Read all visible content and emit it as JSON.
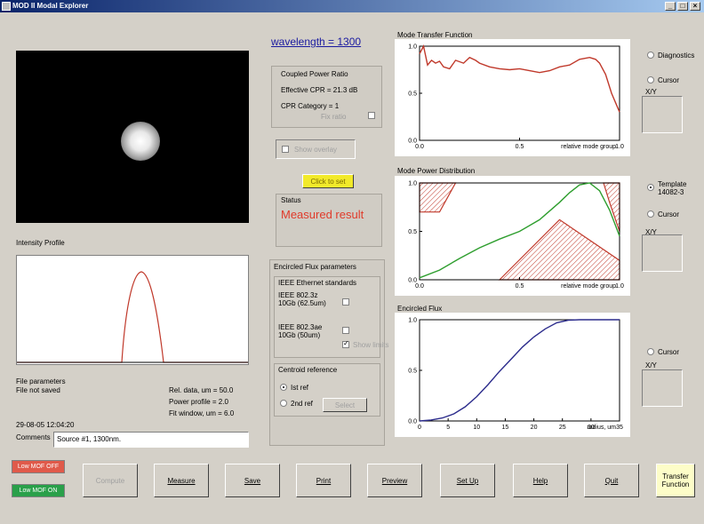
{
  "window": {
    "title": "MOD II Modal Explorer"
  },
  "wavelength_label": "wavelength = 1300",
  "cpr": {
    "title": "Coupled Power Ratio",
    "effective": "Effective CPR = 21.3 dB",
    "category": "CPR Category = 1",
    "sub_label": "Fix ratio"
  },
  "show_overlay": "Show overlay",
  "yellow_button": "Click to set",
  "status": {
    "title": "Status",
    "value": "Measured result"
  },
  "intensity": {
    "title": "Intensity Profile"
  },
  "file": {
    "title": "File parameters",
    "saved": "File not saved",
    "datetime": "29-08-05 12:04:20",
    "comments_label": "Comments",
    "comments_value": "Source #1, 1300nm."
  },
  "params": {
    "rel": "Rel. data, um = 50.0",
    "power": "Power profile = 2.0",
    "fit": "Fit window, um = 6.0"
  },
  "ef_params": {
    "title": "Encircled Flux parameters",
    "ieee_title": "IEEE Ethernet standards",
    "ieee1": "IEEE 802.3z\n10Gb (62.5um)",
    "ieee2": "IEEE 802.3ae\n10Gb (50um)",
    "ieee2_sub": "Show limits"
  },
  "centroid": {
    "title": "Centroid reference",
    "opt1": "Ist ref",
    "opt2": "2nd ref",
    "set_button": "Select"
  },
  "charts": {
    "mtf_title": "Mode Transfer Function",
    "mpd_title": "Mode Power Distribution",
    "ef_title": "Encircled Flux"
  },
  "right": {
    "diagnostics": "Diagnostics",
    "cursor": "Cursor",
    "xy": "X/Y",
    "template": "Template\n14082-3"
  },
  "bottom": {
    "led1": "Low MOF OFF",
    "led2": "Low MOF ON",
    "buttons": [
      "Compute",
      "Measure",
      "Save",
      "Print",
      "Preview",
      "Set Up",
      "Help",
      "Quit"
    ],
    "transfer": "Transfer\nFunction"
  },
  "chart_data": [
    {
      "type": "line",
      "title": "Mode Transfer Function",
      "xlabel": "relative mode group",
      "ylabel": "",
      "xlim": [
        0,
        1.0
      ],
      "ylim": [
        0,
        1.0
      ],
      "x_ticks": [
        "0.0",
        "0.5",
        "1.0"
      ],
      "y_ticks": [
        "0.0",
        "0.5",
        "1.0"
      ],
      "series": [
        {
          "color": "#c0392b",
          "x": [
            0,
            0.02,
            0.04,
            0.06,
            0.08,
            0.1,
            0.12,
            0.15,
            0.18,
            0.22,
            0.25,
            0.28,
            0.3,
            0.35,
            0.4,
            0.45,
            0.5,
            0.55,
            0.6,
            0.65,
            0.7,
            0.75,
            0.8,
            0.85,
            0.88,
            0.9,
            0.93,
            0.96,
            1.0
          ],
          "y": [
            0.92,
            1.0,
            0.8,
            0.85,
            0.82,
            0.84,
            0.78,
            0.76,
            0.85,
            0.82,
            0.88,
            0.85,
            0.82,
            0.78,
            0.76,
            0.75,
            0.76,
            0.74,
            0.72,
            0.74,
            0.78,
            0.8,
            0.86,
            0.88,
            0.86,
            0.82,
            0.7,
            0.5,
            0.3
          ]
        }
      ]
    },
    {
      "type": "line",
      "title": "Mode Power Distribution",
      "xlabel": "relative mode group",
      "ylabel": "",
      "xlim": [
        0,
        1.0
      ],
      "ylim": [
        0,
        1.0
      ],
      "x_ticks": [
        "0.0",
        "0.5",
        "1.0"
      ],
      "y_ticks": [
        "0.0",
        "0.5",
        "1.0"
      ],
      "series": [
        {
          "color": "#2e9e2e",
          "x": [
            0,
            0.1,
            0.2,
            0.3,
            0.4,
            0.5,
            0.6,
            0.7,
            0.75,
            0.8,
            0.85,
            0.9,
            0.95,
            1.0
          ],
          "y": [
            0.02,
            0.1,
            0.22,
            0.33,
            0.42,
            0.5,
            0.62,
            0.8,
            0.9,
            0.98,
            1.0,
            0.92,
            0.72,
            0.45
          ]
        }
      ]
    },
    {
      "type": "line",
      "title": "Encircled Flux",
      "xlabel": "radius, um",
      "ylabel": "",
      "xlim": [
        0,
        35
      ],
      "ylim": [
        0,
        1.0
      ],
      "x_ticks": [
        "0",
        "5",
        "10",
        "15",
        "20",
        "25",
        "30",
        "35"
      ],
      "y_ticks": [
        "0.0",
        "0.5",
        "1.0"
      ],
      "series": [
        {
          "color": "#2c2c8c",
          "x": [
            0,
            2,
            4,
            6,
            8,
            10,
            12,
            14,
            16,
            18,
            20,
            22,
            24,
            26,
            28,
            30,
            32,
            35
          ],
          "y": [
            0,
            0.01,
            0.03,
            0.07,
            0.14,
            0.24,
            0.36,
            0.49,
            0.61,
            0.73,
            0.83,
            0.91,
            0.97,
            0.995,
            1.0,
            1.0,
            1.0,
            1.0
          ]
        }
      ]
    }
  ]
}
